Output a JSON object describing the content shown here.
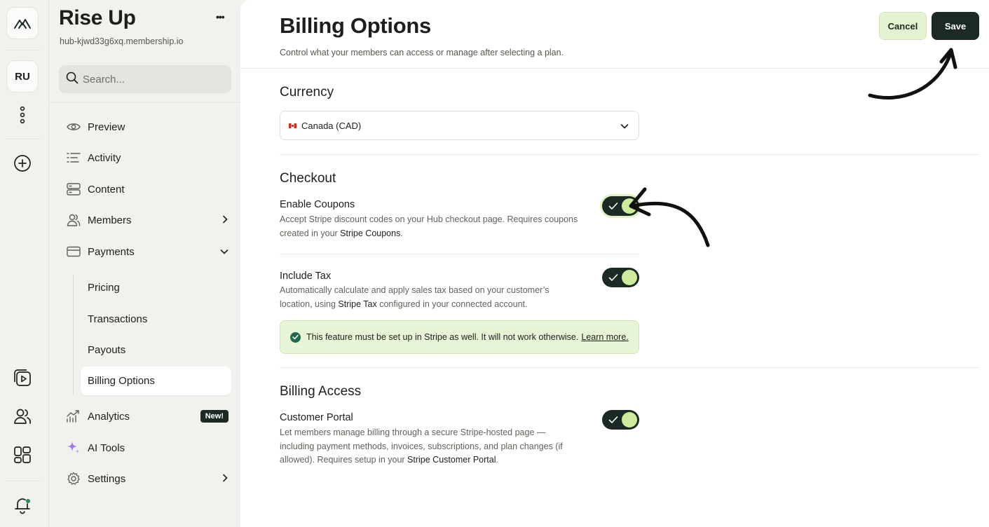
{
  "rail": {
    "logo_icon": "mountain-logo-icon",
    "avatar_initials": "RU"
  },
  "sidebar": {
    "hub_name": "Rise Up",
    "hub_url": "hub-kjwd33g6xq.membership.io",
    "more": "•••",
    "search_placeholder": "Search...",
    "nav": {
      "preview": "Preview",
      "activity": "Activity",
      "content": "Content",
      "members": "Members",
      "payments": "Payments",
      "pricing": "Pricing",
      "transactions": "Transactions",
      "payouts": "Payouts",
      "billing_options": "Billing Options",
      "analytics": "Analytics",
      "analytics_badge": "New!",
      "ai_tools": "AI Tools",
      "settings": "Settings"
    }
  },
  "main": {
    "title": "Billing Options",
    "subtitle": "Control what your members can access or manage after selecting a plan.",
    "cancel": "Cancel",
    "save": "Save",
    "currency": {
      "heading": "Currency",
      "selected": "Canada (CAD)"
    },
    "checkout": {
      "heading": "Checkout",
      "coupons_title": "Enable Coupons",
      "coupons_desc_pre": "Accept Stripe discount codes on your Hub checkout page. Requires coupons created in your ",
      "coupons_link": "Stripe Coupons",
      "coupons_desc_post": ".",
      "coupons_enabled": true,
      "tax_title": "Include Tax",
      "tax_desc_pre": "Automatically calculate and apply sales tax based on your customer’s location, using ",
      "tax_link": "Stripe Tax",
      "tax_desc_post": " configured in your connected account.",
      "tax_enabled": true,
      "notice_text": "This feature must be set up in Stripe as well. It will not work otherwise.",
      "notice_link": "Learn more."
    },
    "billing_access": {
      "heading": "Billing Access",
      "portal_title": "Customer Portal",
      "portal_desc_pre": "Let members manage billing through a secure Stripe-hosted page — including payment methods, invoices, subscriptions, and plan changes (if allowed). Requires setup in your ",
      "portal_link": "Stripe Customer Portal",
      "portal_desc_post": ".",
      "portal_enabled": true
    }
  },
  "colors": {
    "accent_dark": "#1b2a25",
    "accent_light": "#cdeb9b",
    "notice_bg": "#e8f4d6"
  }
}
